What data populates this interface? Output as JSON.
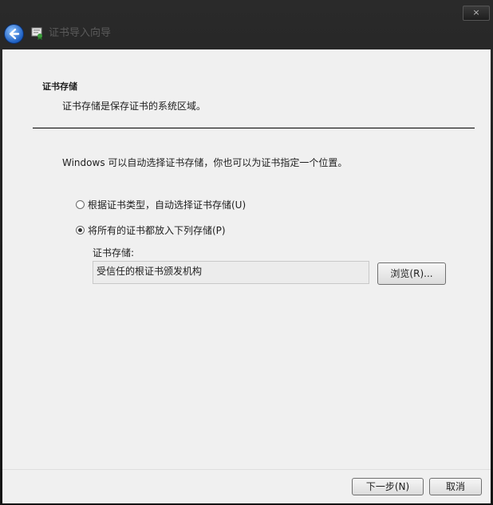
{
  "titlebar": {
    "title": "证书导入向导",
    "close_label": "×"
  },
  "header": {
    "title": "证书存储",
    "description": "证书存储是保存证书的系统区域。"
  },
  "main": {
    "intro": "Windows 可以自动选择证书存储，你也可以为证书指定一个位置。",
    "options": [
      {
        "label": "根据证书类型，自动选择证书存储(U)",
        "selected": false
      },
      {
        "label": "将所有的证书都放入下列存储(P)",
        "selected": true
      }
    ],
    "store_label": "证书存储:",
    "store_value": "受信任的根证书颁发机构",
    "browse_label": "浏览(R)..."
  },
  "footer": {
    "next_label": "下一步(N)",
    "cancel_label": "取消"
  }
}
